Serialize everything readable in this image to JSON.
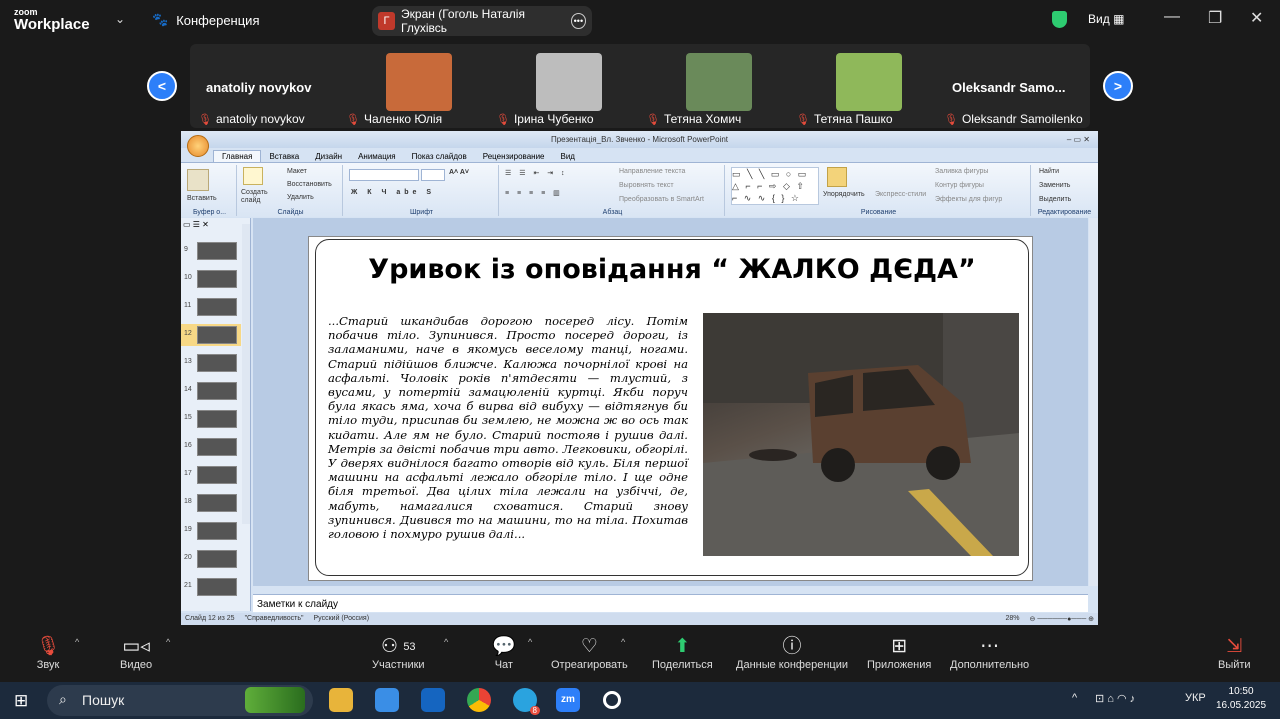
{
  "topbar": {
    "logo_line1": "zoom",
    "logo_line2": "Workplace",
    "conference_label": "Конференция",
    "screen_initial": "Г",
    "screen_share_label": "Экран (Гоголь Наталія Глухівсь",
    "view_label": "Вид"
  },
  "participants": [
    {
      "display": "anatoliy novykov",
      "name": "anatoliy novykov",
      "photo": false
    },
    {
      "display": "",
      "name": "Чаленко Юлія",
      "photo": true,
      "color": "#c86a3a"
    },
    {
      "display": "",
      "name": "Ірина Чубенко",
      "photo": true,
      "color": "#bdbdbd"
    },
    {
      "display": "",
      "name": "Тетяна Хомич",
      "photo": true,
      "color": "#6a8a5a"
    },
    {
      "display": "",
      "name": "Тетяна Пашко",
      "photo": true,
      "color": "#8fb85a"
    },
    {
      "display": "Oleksandr  Samo...",
      "name": "Oleksandr Samoilenko",
      "photo": false
    }
  ],
  "ppt": {
    "window_title": "Презентація_Вл. Звченко - Microsoft PowerPoint",
    "tabs": [
      "Главная",
      "Вставка",
      "Дизайн",
      "Анимация",
      "Показ слайдов",
      "Рецензирование",
      "Вид"
    ],
    "groups": {
      "clipboard": "Буфер о...",
      "slides": "Слайды",
      "font": "Шрифт",
      "paragraph": "Абзац",
      "drawing": "Рисование",
      "editing": "Редактирование"
    },
    "ribbon": {
      "paste": "Вставить",
      "create_slide": "Создать слайд",
      "layout": "Макет",
      "restore": "Восстановить",
      "delete": "Удалить",
      "text_direction": "Направление текста",
      "align_text": "Выровнять текст",
      "smartart": "Преобразовать в SmartArt",
      "arrange": "Упорядочить",
      "express_styles": "Экспресс-стили",
      "shape_fill": "Заливка фигуры",
      "shape_outline": "Контур фигуры",
      "shape_effects": "Эффекты для фигур",
      "find": "Найти",
      "replace": "Заменить",
      "select": "Выделить"
    },
    "thumb_numbers": [
      "9",
      "10",
      "11",
      "12",
      "13",
      "14",
      "15",
      "16",
      "17",
      "18",
      "19",
      "20",
      "21"
    ],
    "selected_thumb": "12",
    "slide_title": "Уривок із оповідання “ ЖАЛКО ДЄДА”",
    "slide_text": "...Старий шкандибав дорогою посеред лісу. Потім побачив тіло. Зупинився. Просто посеред дороги, із заламаними, наче в якомусь веселому танці, ногами. Старий підійшов ближче. Калюжа почорнілої крові на асфальті. Чоловік років п'ятдесяти — тлустий, з вусами, у потертій замацюленій куртці. Якби поруч була якась яма, хоча б вирва від вибуху — відтягнув би тіло туди, присипав би землею, не можна ж во ось так кидати. Але ям не було. Старий постояв і рушив далі. Метрів за двісті побачив три авто. Легковики, обгорілі. У дверях виднілося багато отворів від куль. Біля першої машини на асфальті лежало обгоріле тіло. І ще одне біля третьої. Два цілих тіла лежали на узбіччі, де, мабуть, намагалися сховатися. Старий знову зупинився. Дивився то на машини, то на тіла. Похитав головою і похмуро рушив далі...",
    "notes_placeholder": "Заметки к слайду",
    "status_slide": "Слайд 12 из 25",
    "status_theme": "\"Справедливость\"",
    "status_lang": "Русский (Россия)",
    "zoom": "28%"
  },
  "controls": {
    "sound": "Звук",
    "video": "Видео",
    "participants": "Участники",
    "participants_count": "53",
    "chat": "Чат",
    "react": "Отреагировать",
    "share": "Поделиться",
    "conf_data": "Данные конференции",
    "apps": "Приложения",
    "more": "Дополнительно",
    "leave": "Выйти"
  },
  "taskbar": {
    "search_placeholder": "Пошук",
    "telegram_badge": "8",
    "lang": "УКР",
    "time": "10:50",
    "date": "16.05.2025"
  }
}
